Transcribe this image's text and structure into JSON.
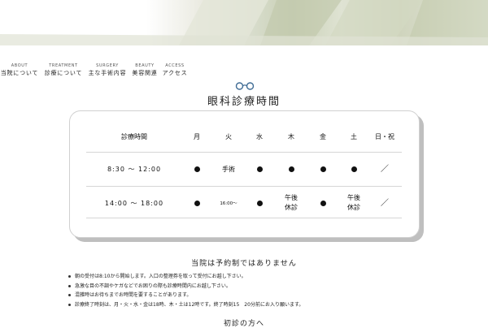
{
  "nav": [
    {
      "en": "ABOUT",
      "jp": "当院について"
    },
    {
      "en": "TREATMENT",
      "jp": "診療について"
    },
    {
      "en": "SURGERY",
      "jp": "主な手術内容"
    },
    {
      "en": "BEAUTY",
      "jp": "美容関連"
    },
    {
      "en": "ACCESS",
      "jp": "アクセス"
    }
  ],
  "page_title": "眼科診療時間",
  "schedule": {
    "headers": [
      "診療時間",
      "月",
      "火",
      "水",
      "木",
      "金",
      "土",
      "日・祝"
    ],
    "rows": [
      {
        "time": "8:30 〜 12:00",
        "cells": [
          "●",
          "手術",
          "●",
          "●",
          "●",
          "●",
          "／"
        ]
      },
      {
        "time": "14:00 〜 18:00",
        "cells": [
          "●",
          "16:00〜",
          "●",
          "午後\n休診",
          "●",
          "午後\n休診",
          "／"
        ]
      }
    ]
  },
  "notice": {
    "title": "当院は予約制ではありません",
    "items": [
      "朝の受付は8:10から開始します。入口の整理券を取って受付にお越し下さい。",
      "急激な目の不調やケガなどでお困りの際も診療時間内にお越し下さい。",
      "混雑時はお待ちまでお時間を要することがあります。",
      "診療終了時刻は、月・火・水・金は18時、木・土は12時です。終了時刻15　20分前にお入り願います。"
    ]
  },
  "next_heading": "初診の方へ",
  "colors": {
    "accent": "#6b8fb0",
    "banner": "#cfd4bd"
  }
}
